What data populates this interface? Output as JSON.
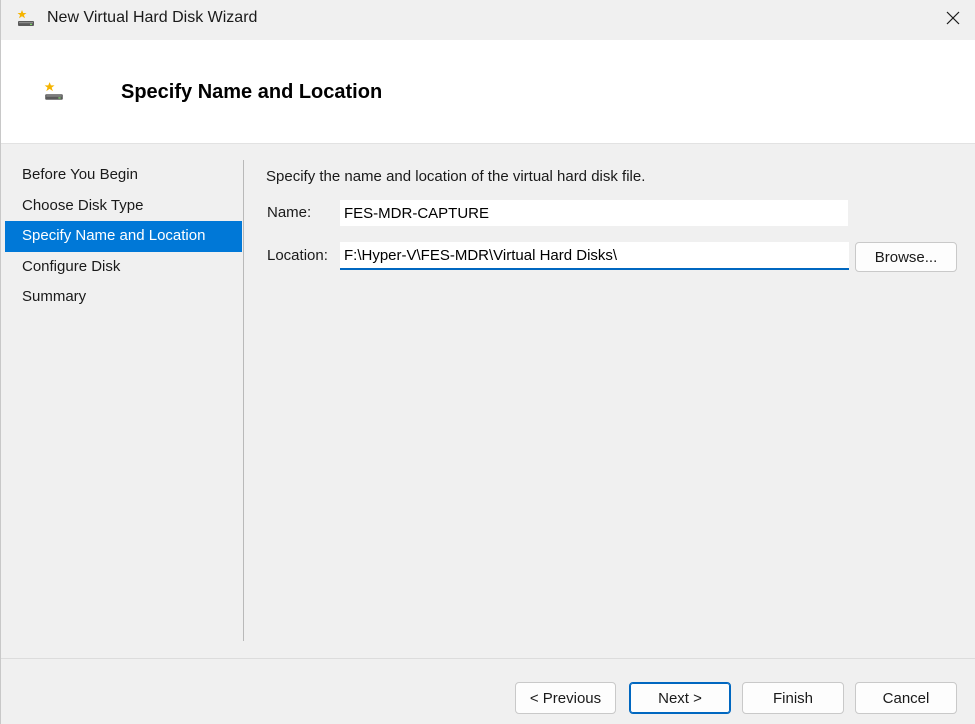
{
  "window": {
    "title": "New Virtual Hard Disk Wizard",
    "app_icon": "virtual-disk-icon",
    "close_glyph": "✕"
  },
  "header": {
    "title": "Specify Name and Location",
    "icon": "virtual-disk-icon"
  },
  "nav": {
    "items": [
      {
        "label": "Before You Begin",
        "selected": false
      },
      {
        "label": "Choose Disk Type",
        "selected": false
      },
      {
        "label": "Specify Name and Location",
        "selected": true
      },
      {
        "label": "Configure Disk",
        "selected": false
      },
      {
        "label": "Summary",
        "selected": false
      }
    ]
  },
  "main": {
    "description": "Specify the name and location of the virtual hard disk file.",
    "name_label": "Name:",
    "name_value": "FES-MDR-CAPTURE",
    "location_label": "Location:",
    "location_value": "F:\\Hyper-V\\FES-MDR\\Virtual Hard Disks\\",
    "browse_label": "Browse..."
  },
  "footer": {
    "previous_label": "< Previous",
    "next_label": "Next >",
    "finish_label": "Finish",
    "cancel_label": "Cancel"
  },
  "colors": {
    "selection": "#0078d7",
    "focus_accent": "#0067c0",
    "header_background": "#ffffff",
    "window_background": "#f0f0f0"
  }
}
